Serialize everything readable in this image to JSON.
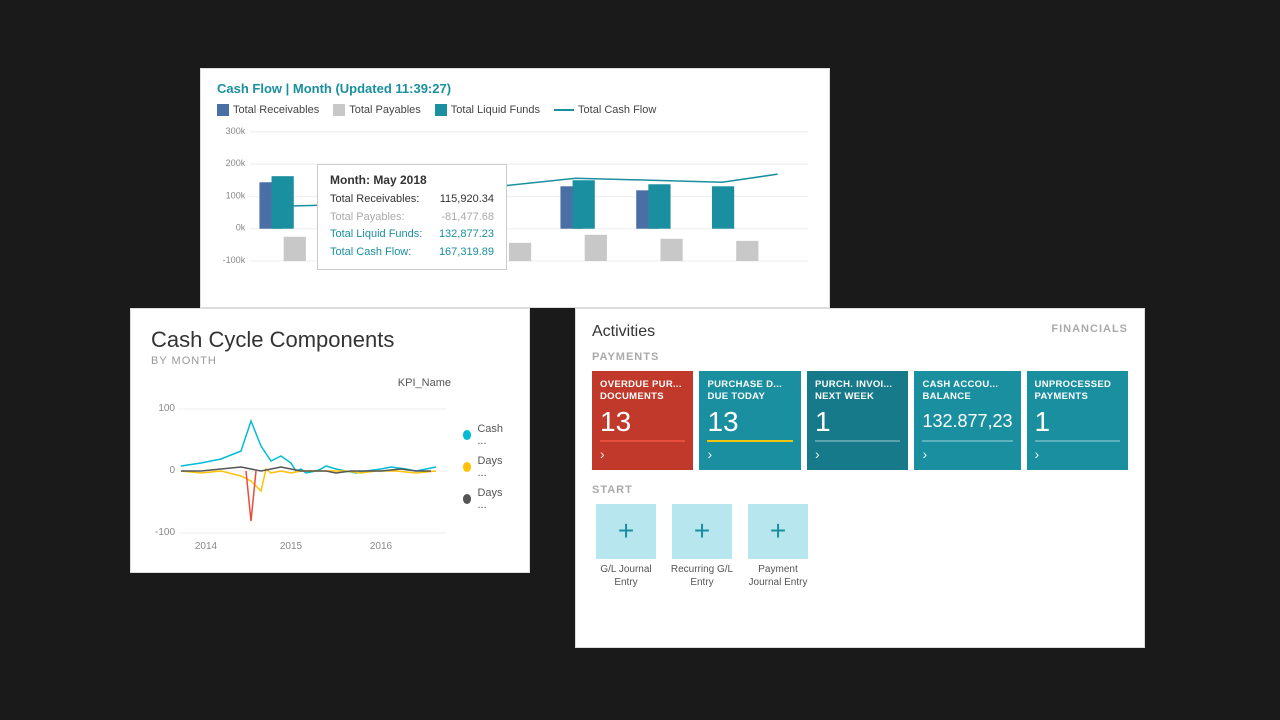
{
  "cashflow": {
    "title": "Cash Flow | Month (Updated 11:39:27)",
    "legend": [
      {
        "label": "Total Receivables",
        "color": "#4a6fa5",
        "type": "box"
      },
      {
        "label": "Total Payables",
        "color": "#c8c8c8",
        "type": "box"
      },
      {
        "label": "Total Liquid Funds",
        "color": "#1a8fa0",
        "type": "box"
      },
      {
        "label": "Total Cash Flow",
        "color": "#1a8fa0",
        "type": "line"
      }
    ],
    "tooltip": {
      "title": "Month: May 2018",
      "rows": [
        {
          "label": "Total Receivables:",
          "value": "115,920.34",
          "style": "normal"
        },
        {
          "label": "Total Payables:",
          "value": "-81,477.68",
          "style": "gray"
        },
        {
          "label": "Total Liquid Funds:",
          "value": "132,877.23",
          "style": "teal"
        },
        {
          "label": "Total Cash Flow:",
          "value": "167,319.89",
          "style": "teal"
        }
      ]
    },
    "yAxis": [
      "300k",
      "200k",
      "100k",
      "0k",
      "-100k"
    ]
  },
  "cashCycle": {
    "title": "Cash Cycle Components",
    "subtitle": "BY MONTH",
    "xAxis": [
      "2014",
      "2015",
      "2016"
    ],
    "yAxis": [
      "100",
      "0",
      "-100"
    ],
    "kpiLabel": "KPI_Name",
    "legend": [
      {
        "label": "Cash ...",
        "color": "#00bcd4"
      },
      {
        "label": "Days ...",
        "color": "#ffc107"
      },
      {
        "label": "Days ...",
        "color": "#555"
      }
    ]
  },
  "activities": {
    "title": "Activities",
    "paymentsLabel": "PAYMENTS",
    "financialsLabel": "FINANCIALS",
    "startLabel": "START",
    "kpis": [
      {
        "label": "OVERDUE PUR... DOCUMENTS",
        "value": "13",
        "color": "red",
        "footerStyle": "red"
      },
      {
        "label": "PURCHASE D... DUE TODAY",
        "value": "13",
        "color": "teal",
        "footerStyle": "yellow"
      },
      {
        "label": "PURCH. INVOI... NEXT WEEK",
        "value": "1",
        "color": "dark-teal",
        "footerStyle": "normal"
      },
      {
        "label": "CASH ACCOU... BALANCE",
        "value": "132.877,23",
        "color": "mid-teal",
        "footerStyle": "normal"
      },
      {
        "label": "UNPROCESSED PAYMENTS",
        "value": "1",
        "color": "mid-teal",
        "footerStyle": "normal"
      }
    ],
    "startItems": [
      {
        "label": "G/L Journal Entry"
      },
      {
        "label": "Recurring G/L Entry"
      },
      {
        "label": "Payment Journal Entry"
      }
    ]
  }
}
